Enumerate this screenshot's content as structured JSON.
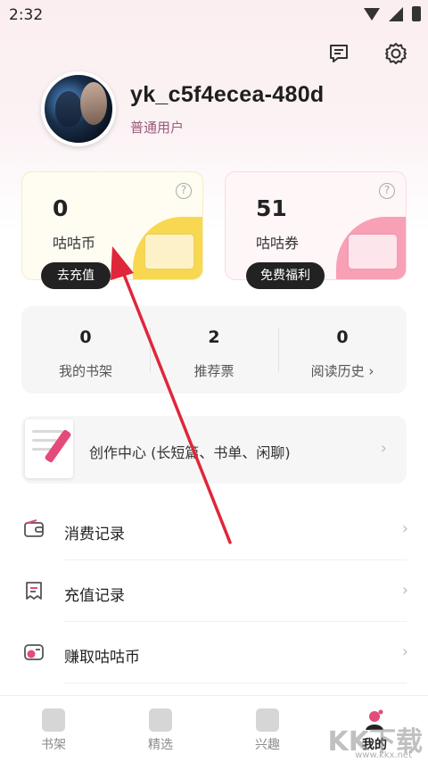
{
  "status_bar": {
    "time": "2:32"
  },
  "profile": {
    "username": "yk_c5f4ecea-480d",
    "level": "普通用户"
  },
  "wallet": {
    "coins": {
      "value": "0",
      "label": "咕咕币",
      "action": "去充值"
    },
    "tickets": {
      "value": "51",
      "label": "咕咕券",
      "action": "免费福利"
    }
  },
  "stats": [
    {
      "value": "0",
      "label": "我的书架"
    },
    {
      "value": "2",
      "label": "推荐票"
    },
    {
      "value": "0",
      "label": "阅读历史 ›"
    }
  ],
  "create_center": {
    "label": "创作中心 (长短篇、书单、闲聊)"
  },
  "menu": [
    {
      "label": "消费记录",
      "icon": "wallet-icon"
    },
    {
      "label": "充值记录",
      "icon": "receipt-icon"
    },
    {
      "label": "赚取咕咕币",
      "icon": "coin-earn-icon"
    }
  ],
  "tabs": [
    {
      "label": "书架",
      "icon": "bookshelf-icon"
    },
    {
      "label": "精选",
      "icon": "featured-icon"
    },
    {
      "label": "兴趣",
      "icon": "interest-icon"
    },
    {
      "label": "我的",
      "icon": "me-icon"
    }
  ],
  "watermark": {
    "text": "KK下载",
    "url": "www.kkx.net"
  },
  "colors": {
    "coin_accent": "#f9d851",
    "ticket_accent": "#f8a0b6",
    "annotation_arrow": "#e0263a"
  }
}
